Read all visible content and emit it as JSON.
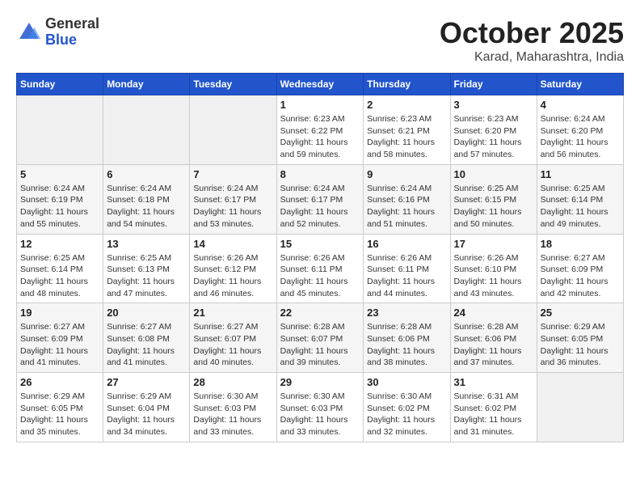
{
  "logo": {
    "general": "General",
    "blue": "Blue"
  },
  "title": "October 2025",
  "subtitle": "Karad, Maharashtra, India",
  "weekdays": [
    "Sunday",
    "Monday",
    "Tuesday",
    "Wednesday",
    "Thursday",
    "Friday",
    "Saturday"
  ],
  "weeks": [
    [
      {
        "day": "",
        "sunrise": "",
        "sunset": "",
        "daylight": ""
      },
      {
        "day": "",
        "sunrise": "",
        "sunset": "",
        "daylight": ""
      },
      {
        "day": "",
        "sunrise": "",
        "sunset": "",
        "daylight": ""
      },
      {
        "day": "1",
        "sunrise": "Sunrise: 6:23 AM",
        "sunset": "Sunset: 6:22 PM",
        "daylight": "Daylight: 11 hours and 59 minutes."
      },
      {
        "day": "2",
        "sunrise": "Sunrise: 6:23 AM",
        "sunset": "Sunset: 6:21 PM",
        "daylight": "Daylight: 11 hours and 58 minutes."
      },
      {
        "day": "3",
        "sunrise": "Sunrise: 6:23 AM",
        "sunset": "Sunset: 6:20 PM",
        "daylight": "Daylight: 11 hours and 57 minutes."
      },
      {
        "day": "4",
        "sunrise": "Sunrise: 6:24 AM",
        "sunset": "Sunset: 6:20 PM",
        "daylight": "Daylight: 11 hours and 56 minutes."
      }
    ],
    [
      {
        "day": "5",
        "sunrise": "Sunrise: 6:24 AM",
        "sunset": "Sunset: 6:19 PM",
        "daylight": "Daylight: 11 hours and 55 minutes."
      },
      {
        "day": "6",
        "sunrise": "Sunrise: 6:24 AM",
        "sunset": "Sunset: 6:18 PM",
        "daylight": "Daylight: 11 hours and 54 minutes."
      },
      {
        "day": "7",
        "sunrise": "Sunrise: 6:24 AM",
        "sunset": "Sunset: 6:17 PM",
        "daylight": "Daylight: 11 hours and 53 minutes."
      },
      {
        "day": "8",
        "sunrise": "Sunrise: 6:24 AM",
        "sunset": "Sunset: 6:17 PM",
        "daylight": "Daylight: 11 hours and 52 minutes."
      },
      {
        "day": "9",
        "sunrise": "Sunrise: 6:24 AM",
        "sunset": "Sunset: 6:16 PM",
        "daylight": "Daylight: 11 hours and 51 minutes."
      },
      {
        "day": "10",
        "sunrise": "Sunrise: 6:25 AM",
        "sunset": "Sunset: 6:15 PM",
        "daylight": "Daylight: 11 hours and 50 minutes."
      },
      {
        "day": "11",
        "sunrise": "Sunrise: 6:25 AM",
        "sunset": "Sunset: 6:14 PM",
        "daylight": "Daylight: 11 hours and 49 minutes."
      }
    ],
    [
      {
        "day": "12",
        "sunrise": "Sunrise: 6:25 AM",
        "sunset": "Sunset: 6:14 PM",
        "daylight": "Daylight: 11 hours and 48 minutes."
      },
      {
        "day": "13",
        "sunrise": "Sunrise: 6:25 AM",
        "sunset": "Sunset: 6:13 PM",
        "daylight": "Daylight: 11 hours and 47 minutes."
      },
      {
        "day": "14",
        "sunrise": "Sunrise: 6:26 AM",
        "sunset": "Sunset: 6:12 PM",
        "daylight": "Daylight: 11 hours and 46 minutes."
      },
      {
        "day": "15",
        "sunrise": "Sunrise: 6:26 AM",
        "sunset": "Sunset: 6:11 PM",
        "daylight": "Daylight: 11 hours and 45 minutes."
      },
      {
        "day": "16",
        "sunrise": "Sunrise: 6:26 AM",
        "sunset": "Sunset: 6:11 PM",
        "daylight": "Daylight: 11 hours and 44 minutes."
      },
      {
        "day": "17",
        "sunrise": "Sunrise: 6:26 AM",
        "sunset": "Sunset: 6:10 PM",
        "daylight": "Daylight: 11 hours and 43 minutes."
      },
      {
        "day": "18",
        "sunrise": "Sunrise: 6:27 AM",
        "sunset": "Sunset: 6:09 PM",
        "daylight": "Daylight: 11 hours and 42 minutes."
      }
    ],
    [
      {
        "day": "19",
        "sunrise": "Sunrise: 6:27 AM",
        "sunset": "Sunset: 6:09 PM",
        "daylight": "Daylight: 11 hours and 41 minutes."
      },
      {
        "day": "20",
        "sunrise": "Sunrise: 6:27 AM",
        "sunset": "Sunset: 6:08 PM",
        "daylight": "Daylight: 11 hours and 41 minutes."
      },
      {
        "day": "21",
        "sunrise": "Sunrise: 6:27 AM",
        "sunset": "Sunset: 6:07 PM",
        "daylight": "Daylight: 11 hours and 40 minutes."
      },
      {
        "day": "22",
        "sunrise": "Sunrise: 6:28 AM",
        "sunset": "Sunset: 6:07 PM",
        "daylight": "Daylight: 11 hours and 39 minutes."
      },
      {
        "day": "23",
        "sunrise": "Sunrise: 6:28 AM",
        "sunset": "Sunset: 6:06 PM",
        "daylight": "Daylight: 11 hours and 38 minutes."
      },
      {
        "day": "24",
        "sunrise": "Sunrise: 6:28 AM",
        "sunset": "Sunset: 6:06 PM",
        "daylight": "Daylight: 11 hours and 37 minutes."
      },
      {
        "day": "25",
        "sunrise": "Sunrise: 6:29 AM",
        "sunset": "Sunset: 6:05 PM",
        "daylight": "Daylight: 11 hours and 36 minutes."
      }
    ],
    [
      {
        "day": "26",
        "sunrise": "Sunrise: 6:29 AM",
        "sunset": "Sunset: 6:05 PM",
        "daylight": "Daylight: 11 hours and 35 minutes."
      },
      {
        "day": "27",
        "sunrise": "Sunrise: 6:29 AM",
        "sunset": "Sunset: 6:04 PM",
        "daylight": "Daylight: 11 hours and 34 minutes."
      },
      {
        "day": "28",
        "sunrise": "Sunrise: 6:30 AM",
        "sunset": "Sunset: 6:03 PM",
        "daylight": "Daylight: 11 hours and 33 minutes."
      },
      {
        "day": "29",
        "sunrise": "Sunrise: 6:30 AM",
        "sunset": "Sunset: 6:03 PM",
        "daylight": "Daylight: 11 hours and 33 minutes."
      },
      {
        "day": "30",
        "sunrise": "Sunrise: 6:30 AM",
        "sunset": "Sunset: 6:02 PM",
        "daylight": "Daylight: 11 hours and 32 minutes."
      },
      {
        "day": "31",
        "sunrise": "Sunrise: 6:31 AM",
        "sunset": "Sunset: 6:02 PM",
        "daylight": "Daylight: 11 hours and 31 minutes."
      },
      {
        "day": "",
        "sunrise": "",
        "sunset": "",
        "daylight": ""
      }
    ]
  ]
}
